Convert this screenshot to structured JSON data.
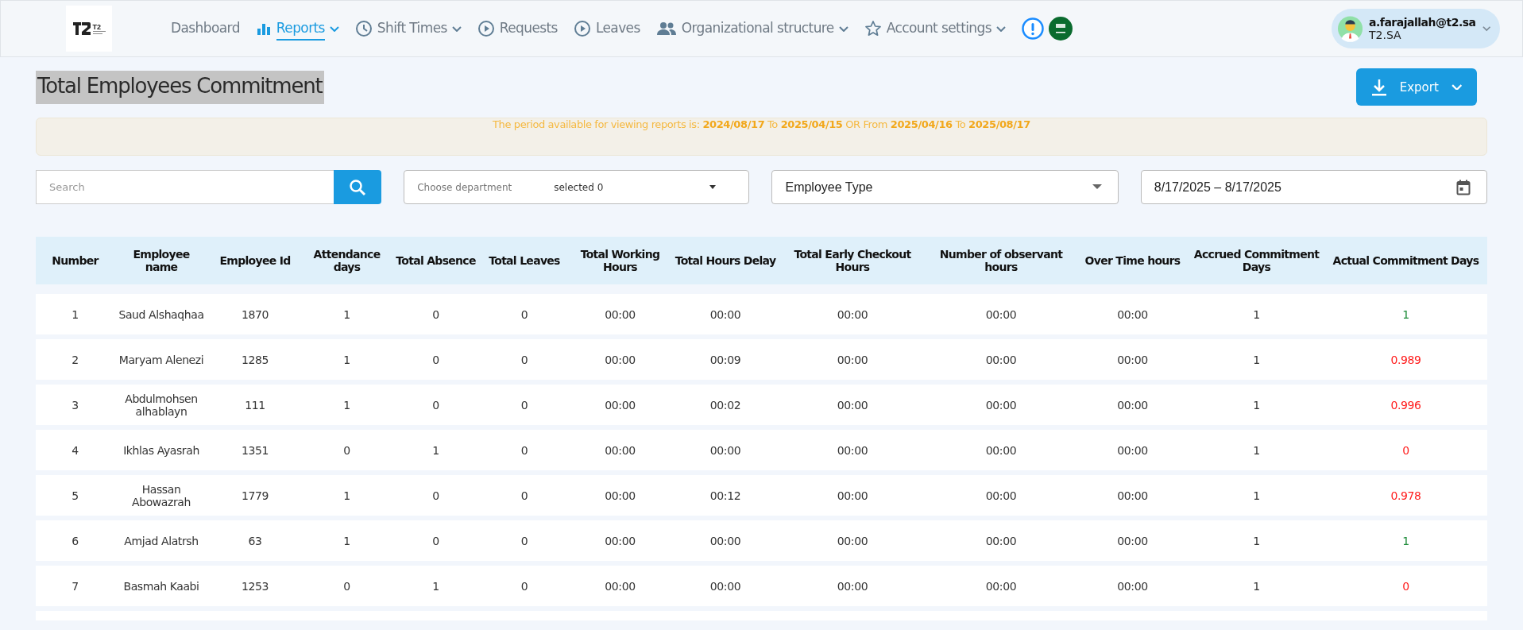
{
  "logo": {
    "mark": "T2"
  },
  "nav": [
    {
      "label": "Dashboard",
      "kind": "plain",
      "dropdown": false,
      "selected": false
    },
    {
      "label": "Reports",
      "kind": "chart",
      "dropdown": true,
      "selected": true
    },
    {
      "label": "Shift Times",
      "kind": "clock",
      "dropdown": true,
      "selected": false
    },
    {
      "label": "Requests",
      "kind": "play",
      "dropdown": false,
      "selected": false
    },
    {
      "label": "Leaves",
      "kind": "play",
      "dropdown": false,
      "selected": false
    },
    {
      "label": "Organizational structure",
      "kind": "people",
      "dropdown": true,
      "selected": false
    },
    {
      "label": "Account settings",
      "kind": "star",
      "dropdown": true,
      "selected": false
    }
  ],
  "user": {
    "email": "a.farajallah@t2.sa",
    "company": "T2.SA"
  },
  "title": "Total Employees Commitment",
  "export_button": "Export",
  "notice": "The period available for viewing reports is: **2024/08/17** To **2025/04/15** OR From **2025/04/16** To **2025/08/17**",
  "filters": {
    "search_placeholder": "Search",
    "department_label": "Choose department",
    "department_value": "selected 0",
    "employee_type": "Employee Type",
    "date_range": "8/17/2025 – 8/17/2025"
  },
  "table": {
    "columns": [
      "Number",
      "Employee name",
      "Employee Id",
      "Attendance days",
      "Total Absence",
      "Total Leaves",
      "Total Working Hours",
      "Total Hours Delay",
      "Total Early Checkout Hours",
      "Number of observant hours",
      "Over Time hours",
      "Accrued Commitment Days",
      "Actual Commitment Days"
    ],
    "rows": [
      {
        "cells": [
          "1",
          "Saud Alshaqhaa",
          "1870",
          "1",
          "0",
          "0",
          "00:00",
          "00:00",
          "00:00",
          "00:00",
          "00:00",
          "1",
          "1"
        ],
        "color": "#1e8c3a"
      },
      {
        "cells": [
          "2",
          "Maryam Alenezi",
          "1285",
          "1",
          "0",
          "0",
          "00:00",
          "00:09",
          "00:00",
          "00:00",
          "00:00",
          "1",
          "0.989"
        ],
        "color": "#ff1a1a"
      },
      {
        "cells": [
          "3",
          "Abdulmohsen alhablayn",
          "111",
          "1",
          "0",
          "0",
          "00:00",
          "00:02",
          "00:00",
          "00:00",
          "00:00",
          "1",
          "0.996"
        ],
        "color": "#ff1a1a"
      },
      {
        "cells": [
          "4",
          "Ikhlas Ayasrah",
          "1351",
          "0",
          "1",
          "0",
          "00:00",
          "00:00",
          "00:00",
          "00:00",
          "00:00",
          "1",
          "0"
        ],
        "color": "#ff1a1a"
      },
      {
        "cells": [
          "5",
          "Hassan Abowazrah",
          "1779",
          "1",
          "0",
          "0",
          "00:00",
          "00:12",
          "00:00",
          "00:00",
          "00:00",
          "1",
          "0.978"
        ],
        "color": "#ff1a1a"
      },
      {
        "cells": [
          "6",
          "Amjad Alatrsh",
          "63",
          "1",
          "0",
          "0",
          "00:00",
          "00:00",
          "00:00",
          "00:00",
          "00:00",
          "1",
          "1"
        ],
        "color": "#1e8c3a"
      },
      {
        "cells": [
          "7",
          "Basmah Kaabi",
          "1253",
          "0",
          "1",
          "0",
          "00:00",
          "00:00",
          "00:00",
          "00:00",
          "00:00",
          "1",
          "0"
        ],
        "color": "#ff1a1a"
      }
    ]
  }
}
